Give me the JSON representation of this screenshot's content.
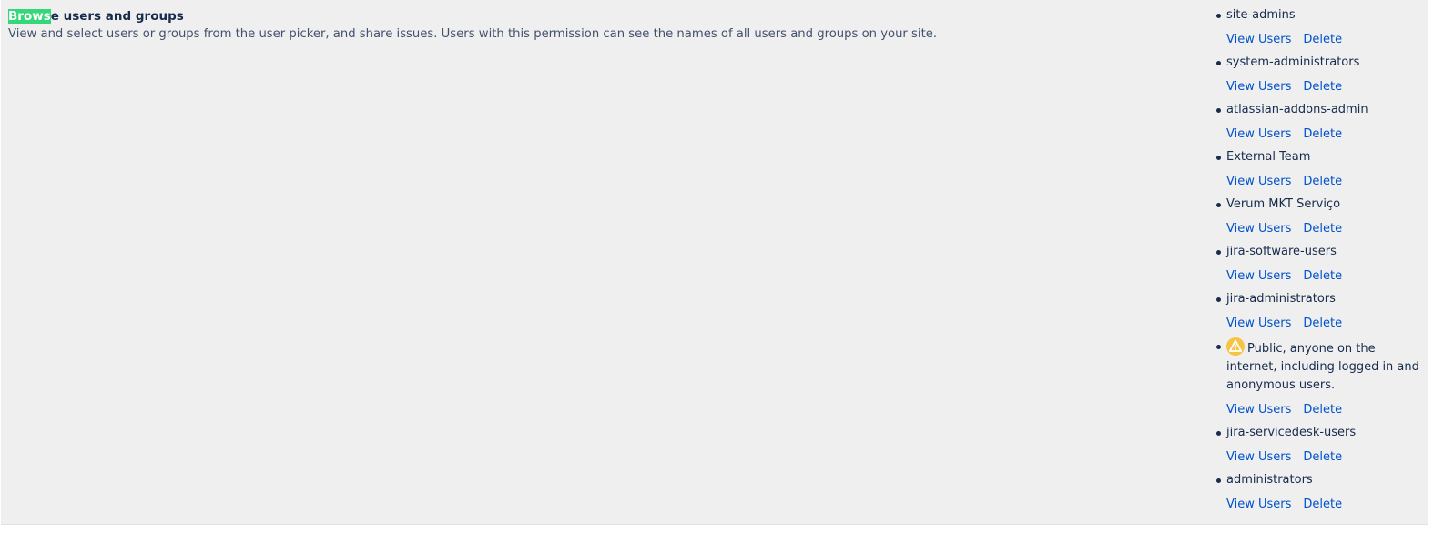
{
  "permission": {
    "title_highlight": "Brows",
    "title_rest": "e users and groups",
    "description": "View and select users or groups from the user picker, and share issues. Users with this permission can see the names of all users and groups on your site."
  },
  "grantees": [
    {
      "name": "site-admins",
      "view_label": "View Users",
      "delete_label": "Delete"
    },
    {
      "name": "system-administrators",
      "view_label": "View Users",
      "delete_label": "Delete"
    },
    {
      "name": "atlassian-addons-admin",
      "view_label": "View Users",
      "delete_label": "Delete"
    },
    {
      "name": "External Team",
      "view_label": "View Users",
      "delete_label": "Delete"
    },
    {
      "name": "Verum MKT Serviço",
      "view_label": "View Users",
      "delete_label": "Delete"
    },
    {
      "name": "jira-software-users",
      "view_label": "View Users",
      "delete_label": "Delete"
    },
    {
      "name": "jira-administrators",
      "view_label": "View Users",
      "delete_label": "Delete"
    },
    {
      "name": "Public, anyone on the internet, including logged in and anonymous users.",
      "icon": "warning-icon",
      "view_label": "View Users",
      "delete_label": "Delete"
    },
    {
      "name": "jira-servicedesk-users",
      "view_label": "View Users",
      "delete_label": "Delete"
    },
    {
      "name": "administrators",
      "view_label": "View Users",
      "delete_label": "Delete"
    }
  ],
  "colors": {
    "highlight": "#36d67a",
    "link": "#0052cc",
    "warning": "#f6c342",
    "background": "#efefef"
  }
}
